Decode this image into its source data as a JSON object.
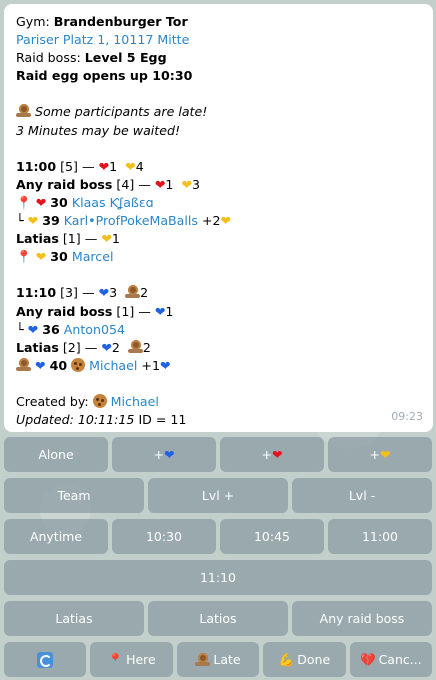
{
  "message": {
    "gym_label": "Gym:",
    "gym_name": "Brandenburger Tor",
    "address": "Pariser Platz 1, 10117 Mitte",
    "raid_boss_label": "Raid boss:",
    "raid_boss": "Level 5 Egg",
    "egg_opens": "Raid egg opens up 10:30",
    "late_note_1": "Some participants are late!",
    "late_note_2": "3 Minutes may be waited!",
    "slot1": {
      "time": "11:00",
      "count": "[5] —",
      "red_count": "1",
      "yellow_count": "4",
      "any_label": "Any raid boss",
      "any_count": "[4] —",
      "any_red": "1",
      "any_yellow": "3",
      "p1_level": "30",
      "p1_name": "Klaas Ƙʆaßɛɑ",
      "p2_level": "39",
      "p2_name": "Karl•ProfPokeMaBalls",
      "p2_extra": "+2",
      "latias_label": "Latias",
      "latias_count": "[1] —",
      "latias_yellow": "1",
      "p3_level": "30",
      "p3_name": "Marcel"
    },
    "slot2": {
      "time": "11:10",
      "count": "[3] —",
      "blue_count": "3",
      "late_count": "2",
      "any_label": "Any raid boss",
      "any_count": "[1] —",
      "any_blue": "1",
      "p1_level": "36",
      "p1_name": "Anton054",
      "latias_label": "Latias",
      "latias_count": "[2] —",
      "latias_blue": "2",
      "latias_late": "2",
      "p2_level": "40",
      "p2_name": "Michael",
      "p2_extra": "+1"
    },
    "created_by_label": "Created by:",
    "creator": "Michael",
    "updated": "Updated: 10:11:15",
    "id_text": "ID = 11",
    "timestamp": "09:23"
  },
  "keyboard": {
    "row1": [
      "Alone",
      "+",
      "+",
      "+"
    ],
    "row2": [
      "Team",
      "Lvl +",
      "Lvl -"
    ],
    "row3": [
      "Anytime",
      "10:30",
      "10:45",
      "11:00"
    ],
    "row4": [
      "11:10"
    ],
    "row5": [
      "Latias",
      "Latios",
      "Any raid boss"
    ],
    "row6": [
      "",
      "Here",
      "Late",
      "Done",
      "Canc..."
    ]
  },
  "colors": {
    "link": "#2a86c8",
    "button_bg": "#80919b",
    "heart_red": "#e3121b",
    "heart_yellow": "#f5be18",
    "heart_blue": "#1f62e6"
  }
}
